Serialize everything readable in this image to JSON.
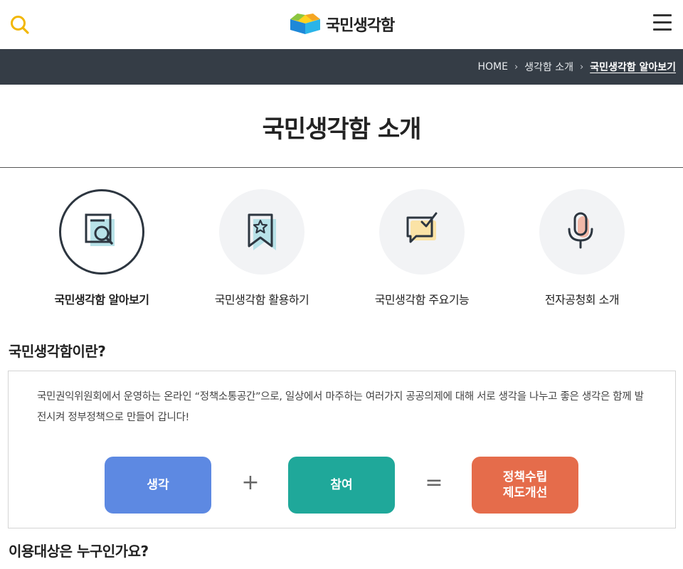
{
  "header": {
    "logo_text": "국민생각함",
    "search_icon": "search-icon",
    "menu_icon": "hamburger-menu-icon",
    "accent_color": "#f2b705"
  },
  "breadcrumb": {
    "items": [
      "HOME",
      "생각함 소개",
      "국민생각함 알아보기"
    ]
  },
  "page_title": "국민생각함 소개",
  "nav": {
    "items": [
      {
        "label": "국민생각함 알아보기",
        "icon": "document-search-icon",
        "active": true
      },
      {
        "label": "국민생각함 활용하기",
        "icon": "bookmark-star-icon",
        "active": false
      },
      {
        "label": "국민생각함 주요기능",
        "icon": "chat-check-icon",
        "active": false
      },
      {
        "label": "전자공청회 소개",
        "icon": "microphone-icon",
        "active": false
      }
    ]
  },
  "section1": {
    "heading": "국민생각함이란?",
    "description": "국민권익위원회에서 운영하는 온라인 “정책소통공간”으로, 일상에서 마주하는 여러가지 공공의제에 대해 서로 생각을 나누고 좋은 생각은 함께 발전시켜 정부정책으로 만들어 갑니다!",
    "formula": {
      "term1": "생각",
      "op1": "+",
      "term2": "참여",
      "op2": "=",
      "result": "정책수립\n제도개선"
    },
    "colors": {
      "term1": "#5d89e2",
      "term2": "#1fa89a",
      "result": "#e56c4b"
    }
  },
  "section2": {
    "heading": "이용대상은 누구인가요?"
  }
}
